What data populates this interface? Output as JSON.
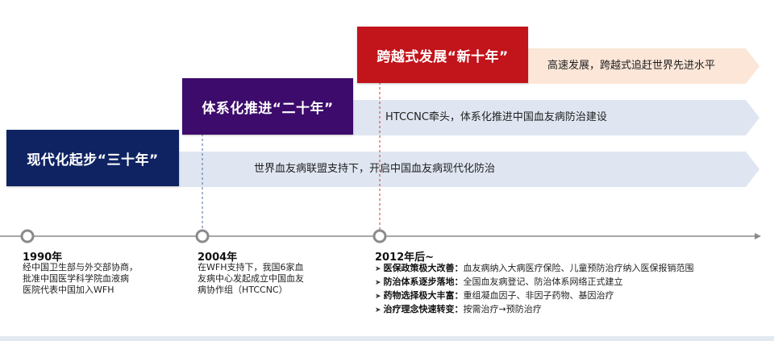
{
  "colors": {
    "stage1": "#0f2362",
    "stage2": "#3c0b6b",
    "stage3": "#c2141b",
    "arrow_blue": "#dfe6f1",
    "arrow_peach": "#fbe6d8",
    "dash_blue": "#4a6aa0",
    "dash_red": "#d2322f",
    "timeline": "#8a8a8a"
  },
  "stages": [
    {
      "title": "现代化起步“三十年”",
      "arrow_text": "世界血友病联盟支持下，开启中国血友病现代化防治"
    },
    {
      "title": "体系化推进“二十年”",
      "arrow_text": "HTCCNC牵头，体系化推进中国血友病防治建设"
    },
    {
      "title": "跨越式发展“新十年”",
      "arrow_text": "高速发展，跨越式追赶世界先进水平"
    }
  ],
  "milestones": [
    {
      "year": "1990年",
      "lines": [
        "经中国卫生部与外交部协商，",
        "批准中国医学科学院血液病",
        "医院代表中国加入WFH"
      ]
    },
    {
      "year": "2004年",
      "lines": [
        "在WFH支持下，我国6家血",
        "友病中心发起成立中国血友",
        "病协作组（HTCCNC）"
      ]
    },
    {
      "year": "2012年后~",
      "bullets": [
        {
          "title": "医保政策极大改善：",
          "text": "血友病纳入大病医疗保险、儿童预防治疗纳入医保报销范围"
        },
        {
          "title": "防治体系逐步落地：",
          "text": "全国血友病登记、防治体系网络正式建立"
        },
        {
          "title": "药物选择极大丰富：",
          "text": "重组凝血因子、非因子药物、基因治疗"
        },
        {
          "title": "治疗理念快速转变：",
          "text": "按需治疗→预防治疗"
        }
      ]
    }
  ]
}
